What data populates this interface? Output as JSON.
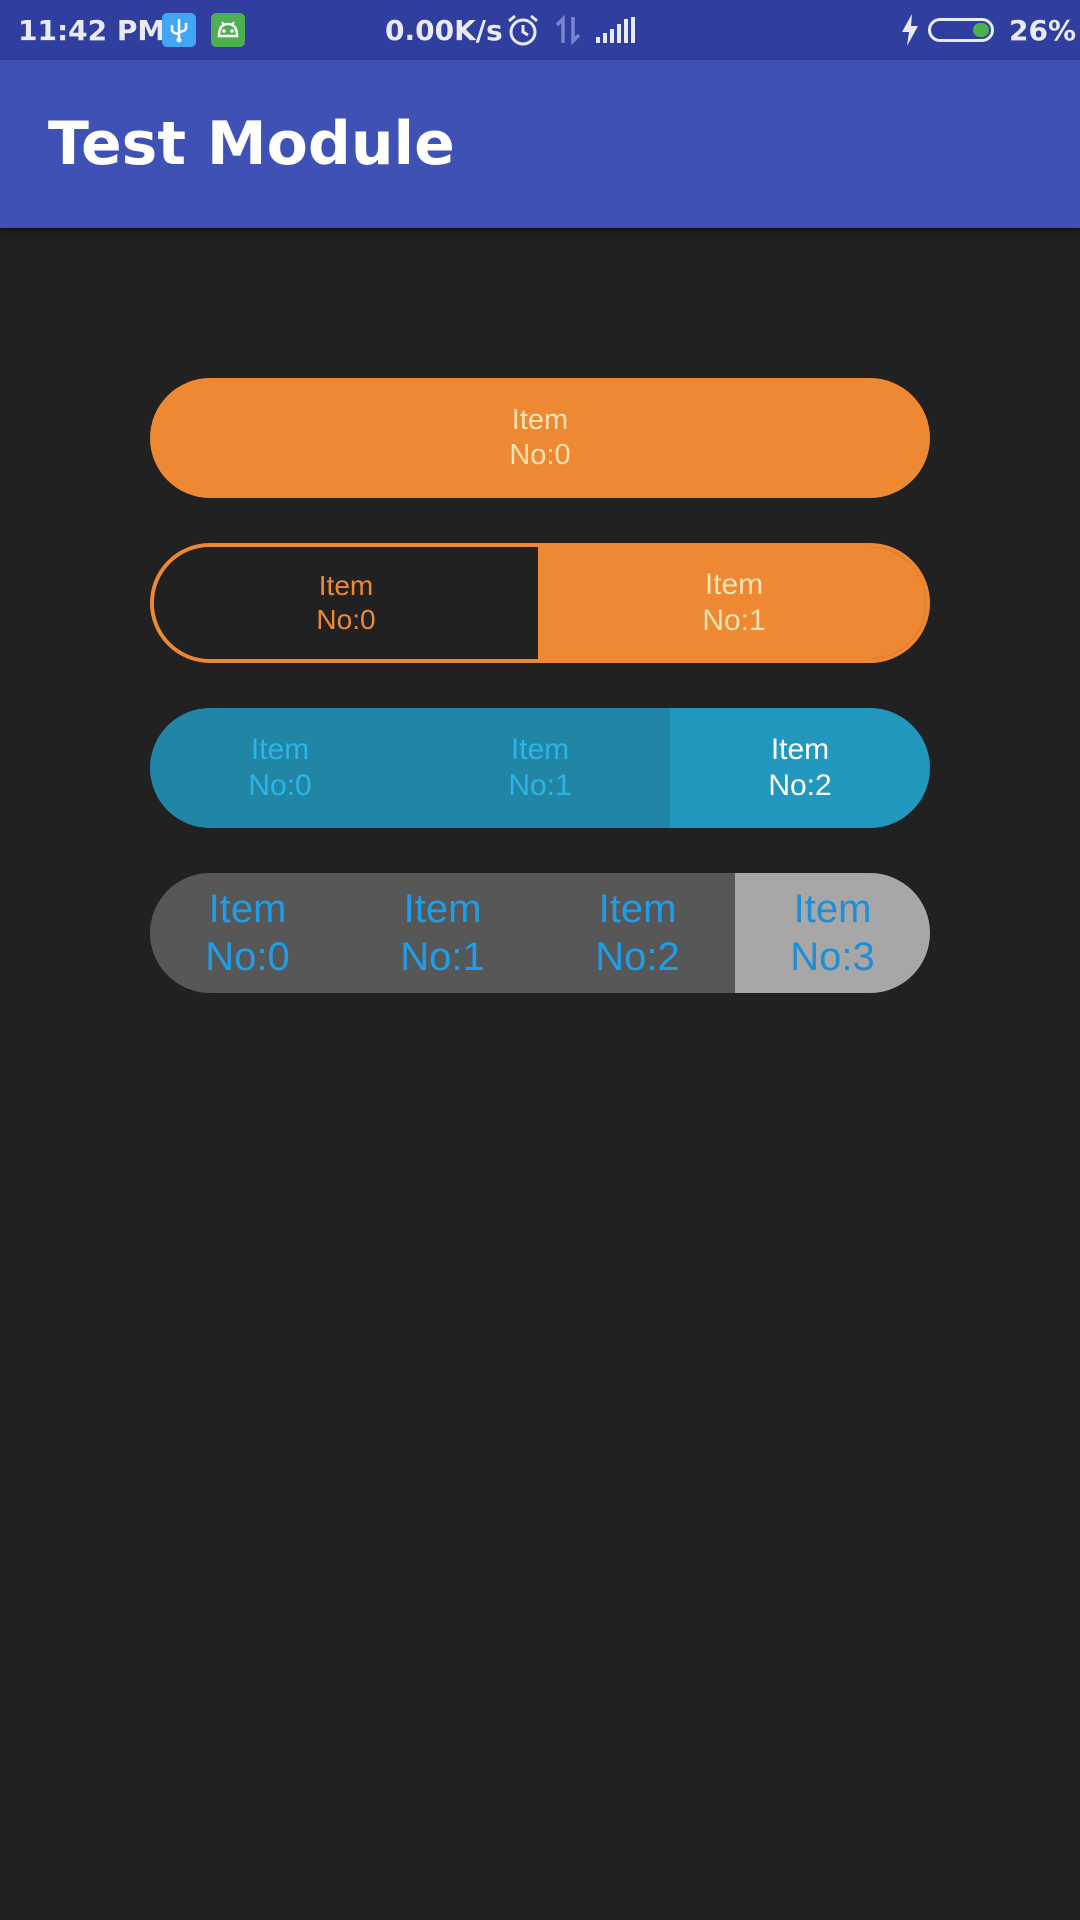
{
  "status_bar": {
    "time": "11:42 PM",
    "net_speed": "0.00K/s",
    "battery_percent": "26%",
    "battery_level": 0.26,
    "icons": [
      "usb-icon",
      "android-icon",
      "alarm-icon",
      "data-transfer-icon",
      "signal-icon",
      "charging-icon",
      "battery-icon"
    ]
  },
  "app_bar": {
    "title": "Test Module"
  },
  "segments": [
    {
      "items": [
        {
          "line1": "Item",
          "line2": "No:0"
        }
      ],
      "selected": 0,
      "style": "orange-filled"
    },
    {
      "items": [
        {
          "line1": "Item",
          "line2": "No:0"
        },
        {
          "line1": "Item",
          "line2": "No:1"
        }
      ],
      "selected": 1,
      "style": "orange-outline"
    },
    {
      "items": [
        {
          "line1": "Item",
          "line2": "No:0"
        },
        {
          "line1": "Item",
          "line2": "No:1"
        },
        {
          "line1": "Item",
          "line2": "No:2"
        }
      ],
      "selected": 2,
      "style": "blue"
    },
    {
      "items": [
        {
          "line1": "Item",
          "line2": "No:0"
        },
        {
          "line1": "Item",
          "line2": "No:1"
        },
        {
          "line1": "Item",
          "line2": "No:2"
        },
        {
          "line1": "Item",
          "line2": "No:3"
        }
      ],
      "selected": 3,
      "style": "gray"
    }
  ],
  "colors": {
    "status_bar": "#303f9f",
    "app_bar": "#3f51b5",
    "background": "#212121",
    "orange": "#ef8833",
    "blue_unselected": "#2185a6",
    "blue_selected": "#2398be",
    "gray_unselected": "#575757",
    "gray_selected": "#a7a7a7"
  }
}
